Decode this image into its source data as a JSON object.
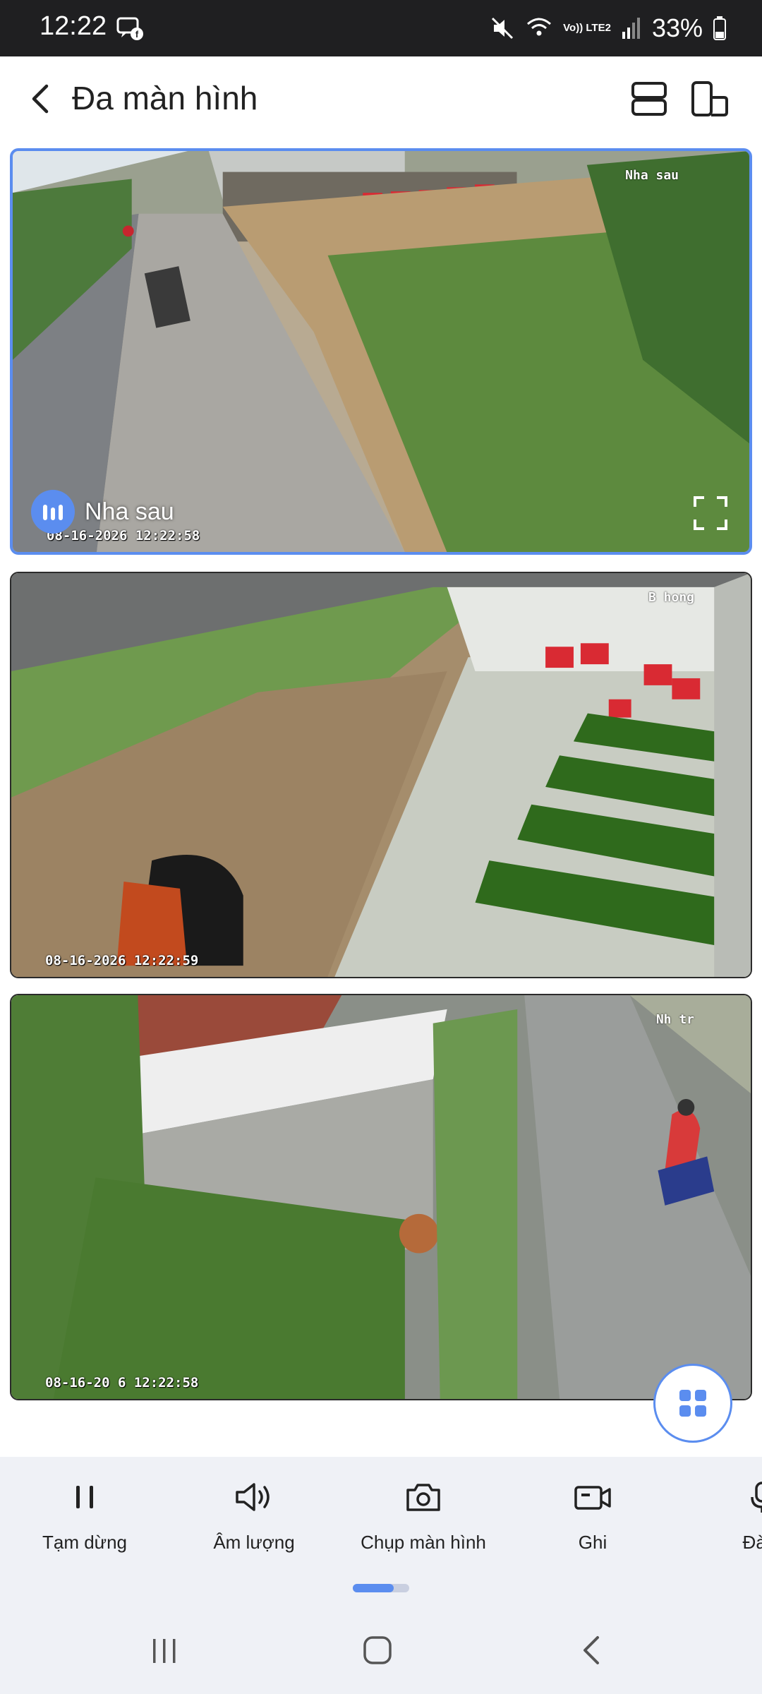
{
  "status_bar": {
    "time": "12:22",
    "network": "Vo)) LTE2",
    "battery": "33%",
    "icons": [
      "chat-icon",
      "mute-icon",
      "wifi-icon",
      "signal-icon",
      "battery-icon"
    ]
  },
  "header": {
    "title": "Đa màn hình",
    "back_icon": "chevron-left-icon",
    "layout_icons": [
      "split-vertical-icon",
      "split-horizontal-icon"
    ]
  },
  "cameras": [
    {
      "name": "Nha sau",
      "osd_name": "Nha sau",
      "timestamp": "08-16-2026 12:22:58",
      "selected": true,
      "label": "Nha sau"
    },
    {
      "name": "B hong",
      "osd_name": "B hong",
      "timestamp": "08-16-2026 12:22:59",
      "selected": false
    },
    {
      "name": "Nh tr",
      "osd_name": "Nh tr",
      "timestamp": "08-16-20 6 12:22:58",
      "selected": false
    }
  ],
  "toolbar": {
    "items": [
      {
        "label": "Tạm dừng",
        "icon": "pause-icon"
      },
      {
        "label": "Âm lượng",
        "icon": "volume-icon"
      },
      {
        "label": "Chụp màn hình",
        "icon": "camera-icon"
      },
      {
        "label": "Ghi",
        "icon": "video-record-icon"
      },
      {
        "label": "Đàm",
        "icon": "microphone-icon"
      }
    ],
    "page_indicator_progress": 0.72
  },
  "nav": {
    "buttons": [
      "recent-apps-icon",
      "home-icon",
      "back-icon"
    ]
  },
  "colors": {
    "accent": "#5b8def",
    "status_bar": "#1f1f21",
    "toolbar_bg": "#eff1f6"
  }
}
